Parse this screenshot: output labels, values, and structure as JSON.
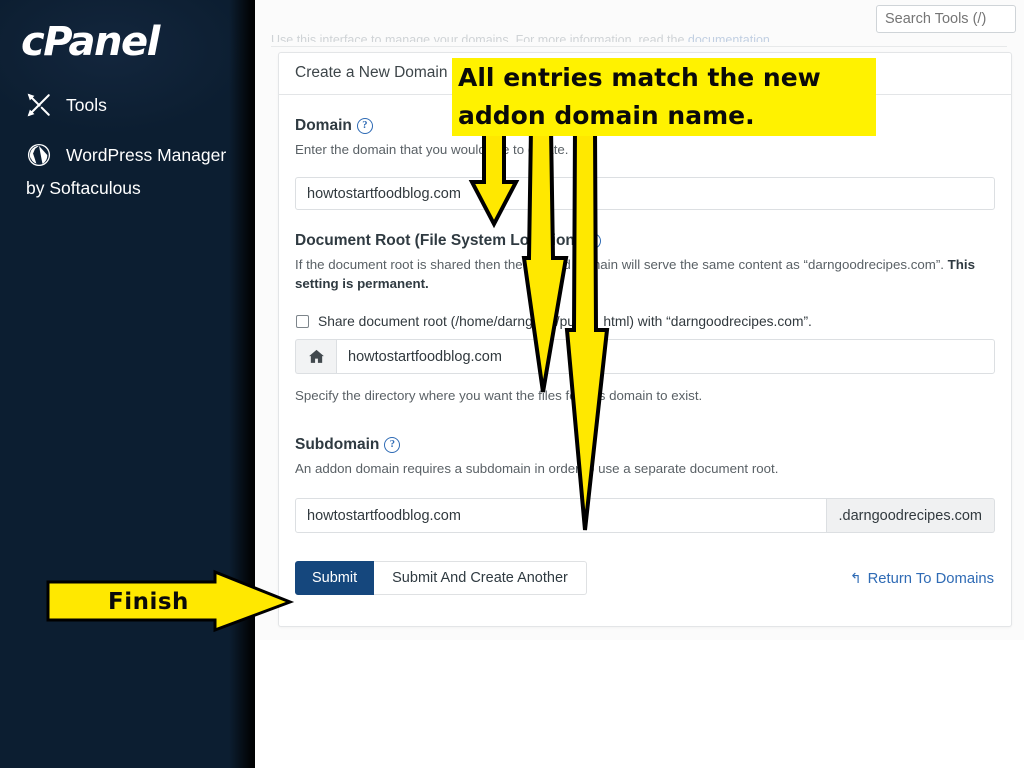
{
  "sidebar": {
    "brand": "cPanel",
    "items": [
      {
        "label": "Tools",
        "icon": "tools-icon"
      },
      {
        "label": "WordPress Manager",
        "icon": "wordpress-icon"
      }
    ],
    "subtitle": "by Softaculous"
  },
  "header": {
    "search_placeholder": "Search Tools (/)",
    "search_value": ""
  },
  "intro": {
    "text": "Use this interface to manage your domains. For more information, read the ",
    "doc_link": "documentation."
  },
  "card": {
    "title": "Create a New Domain",
    "domain": {
      "label": "Domain",
      "help_icon": "?",
      "description": "Enter the domain that you would like to create.",
      "value": "howtostartfoodblog.com"
    },
    "document_root": {
      "label": "Document Root (File System Location)",
      "help_icon": "?",
      "description_1": "If the document root is shared then the created domain will serve the same content as “darngoodrecipes.com”. ",
      "description_bold": "This setting is permanent.",
      "share_checkbox_label": "Share document root (/home/darngood/public_html) with “darngoodrecipes.com”.",
      "share_checked": false,
      "prefix_icon": "home-icon",
      "value": "howtostartfoodblog.com",
      "help_text": "Specify the directory where you want the files for this domain to exist."
    },
    "subdomain": {
      "label": "Subdomain",
      "help_icon": "?",
      "description": "An addon domain requires a subdomain in order to use a separate document root.",
      "value": "howtostartfoodblog.com",
      "suffix": ".darngoodrecipes.com"
    },
    "actions": {
      "submit": "Submit",
      "submit_another": "Submit And Create Another",
      "return_link": "Return To Domains",
      "return_icon": "↰"
    }
  },
  "annotations": {
    "callout_line_1": "All entries match the new",
    "callout_line_2": "addon domain name.",
    "finish_label": "Finish",
    "highlight_color": "#fff200",
    "arrow_color": "#ffe800",
    "arrow_outline": "#000000"
  },
  "colors": {
    "sidebar_bg": "#0d2033",
    "accent_blue": "#15477d",
    "link_blue": "#2f6bb5",
    "page_bg": "#fbfbfb"
  }
}
